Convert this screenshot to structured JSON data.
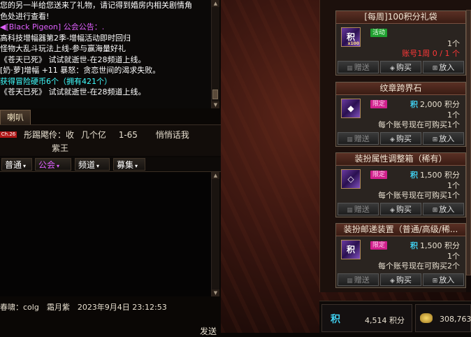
{
  "chat": {
    "lines": [
      {
        "text": "您的另一半给您送来了礼物，请记得到婚房内相关剧情角",
        "color": "#ffffff"
      },
      {
        "text": "色处进行查看!",
        "color": "#ffffff"
      },
      {
        "text": "◀[Black Pigeon] 公会公告：.",
        "color": "#e060ff"
      },
      {
        "text": "高科技增幅器第2季-增幅活动即时回归",
        "color": "#ffffff"
      },
      {
        "text": "怪物大乱斗玩法上线-参与赢海量好礼",
        "color": "#ffffff"
      },
      {
        "text": "《苍天已死》 试试就逝世-在28频道上线。",
        "color": "#ffffff"
      },
      {
        "text": "[奶·萝]增幅 +11 暴怒：贪恋世间的渴求失败。",
        "color": "#ffffff"
      },
      {
        "text": "获得冒险硬币6个（拥有421个）",
        "color": "#40ffff"
      },
      {
        "text": "《苍天已死》 试试就逝世-在28频道上线。",
        "color": "#ffffff"
      }
    ],
    "horn_tab": "喇叭",
    "horn": {
      "channel": "Ch.26",
      "sender": "彤踢飔伶：收",
      "msg_a": "几个亿",
      "msg_b": "1-65",
      "msg_c": "悄悄话我",
      "msg_d": "紫王"
    },
    "tabs": [
      {
        "label": "普通",
        "color": "#ffffff"
      },
      {
        "label": "公会",
        "color": "#e060ff"
      },
      {
        "label": "频道",
        "color": "#ffffff"
      },
      {
        "label": "募集",
        "color": "#ffffff"
      }
    ],
    "system_line": "春啸：colg　霜月紫　2023年9月4日 23:12:53",
    "send_label": "发送"
  },
  "shop": {
    "items": [
      {
        "title": "[每周]100积分礼袋",
        "icon_text": "积",
        "icon_sub": "x100",
        "badge": "活动",
        "badge_type": "green",
        "price": "",
        "qty": "1个",
        "limit": "账号1周 0 / 1 个",
        "limit_red": true
      },
      {
        "title": "纹章跨界石",
        "icon_text": "◆",
        "icon_sub": "",
        "badge": "限定",
        "badge_type": "pink",
        "price": "2,000 积分",
        "qty": "1个",
        "limit": "每个账号现在可购买1个",
        "limit_red": false
      },
      {
        "title": "装扮属性调整箱（稀有）",
        "icon_text": "◇",
        "icon_sub": "",
        "badge": "限定",
        "badge_type": "pink",
        "price": "1,500 积分",
        "qty": "1个",
        "limit": "每个账号现在可购买1个",
        "limit_red": false
      },
      {
        "title": "装扮邮递装置（普通/高级/稀...",
        "icon_text": "积",
        "icon_sub": "",
        "badge": "限定",
        "badge_type": "pink",
        "price": "1,500 积分",
        "qty": "1个",
        "limit": "每个账号现在可购买2个",
        "limit_red": false
      }
    ],
    "btn_gift": "赠送",
    "btn_buy": "购买",
    "btn_cart": "放入",
    "points_icon": "积",
    "points_value": "4,514 积分",
    "gold_value": "308,763,4"
  }
}
